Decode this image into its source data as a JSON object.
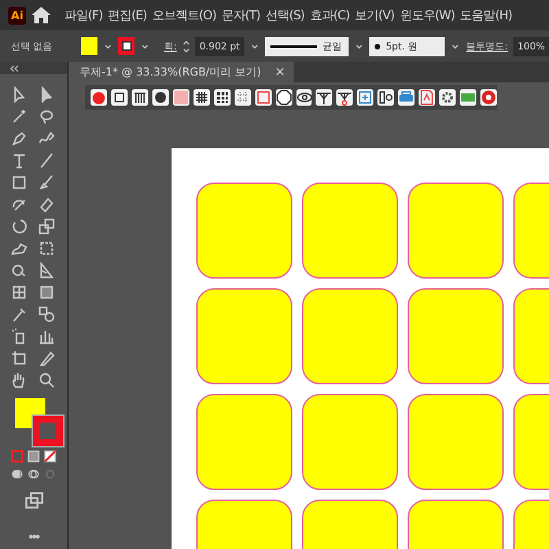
{
  "app": {
    "logo": "Ai"
  },
  "menu": [
    "파일(F)",
    "편집(E)",
    "오브젝트(O)",
    "문자(T)",
    "선택(S)",
    "효과(C)",
    "보기(V)",
    "윈도우(W)",
    "도움말(H)"
  ],
  "control_bar": {
    "selection": "선택 없음",
    "stroke_label": "획:",
    "stroke_weight": "0.902 pt",
    "profile": "균일",
    "brush": "5pt. 원",
    "opacity_label": "불투명도:",
    "opacity": "100%"
  },
  "document_tab": {
    "title": "무제-1* @ 33.33%(RGB/미리 보기)",
    "close": "×",
    "selected": true
  }
}
